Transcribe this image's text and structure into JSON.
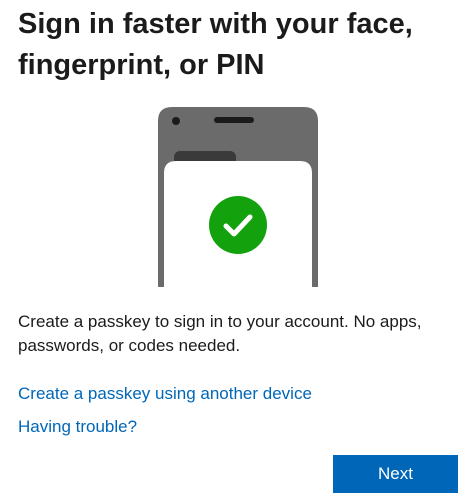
{
  "header": {
    "title": "Sign in faster with your face, fingerprint, or PIN"
  },
  "illustration": {
    "icon": "check-icon",
    "check_color": "#13a10e",
    "phone_color": "#6b6b6b"
  },
  "body": {
    "description": "Create a passkey to sign in to your account. No apps, passwords, or codes needed."
  },
  "links": {
    "other_device": "Create a passkey using another device",
    "trouble": "Having trouble?"
  },
  "actions": {
    "next_label": "Next",
    "accent_color": "#0067b8"
  }
}
